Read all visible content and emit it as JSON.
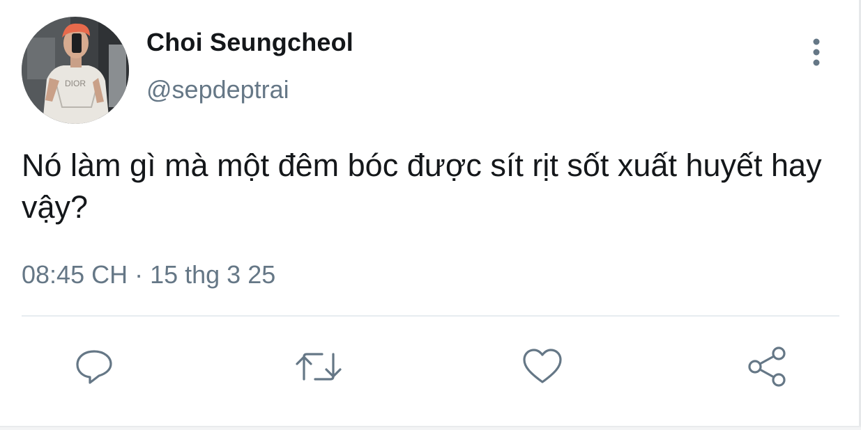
{
  "tweet": {
    "author": {
      "display_name": "Choi Seungcheol",
      "handle": "@sepdeptrai",
      "avatar_icon": "profile-photo"
    },
    "text": "Nó làm gì mà một đêm bóc được sít rịt sốt xuất huyết hay vậy?",
    "timestamp": "08:45 CH · 15 thg 3 25"
  },
  "actions": [
    {
      "name": "reply",
      "icon": "speech-bubble-icon"
    },
    {
      "name": "retweet",
      "icon": "retweet-arrows-icon"
    },
    {
      "name": "like",
      "icon": "heart-icon"
    },
    {
      "name": "share",
      "icon": "share-nodes-icon"
    }
  ],
  "colors": {
    "text_primary": "#14171a",
    "text_secondary": "#657786",
    "divider": "#e6ecf0",
    "background": "#ffffff"
  }
}
